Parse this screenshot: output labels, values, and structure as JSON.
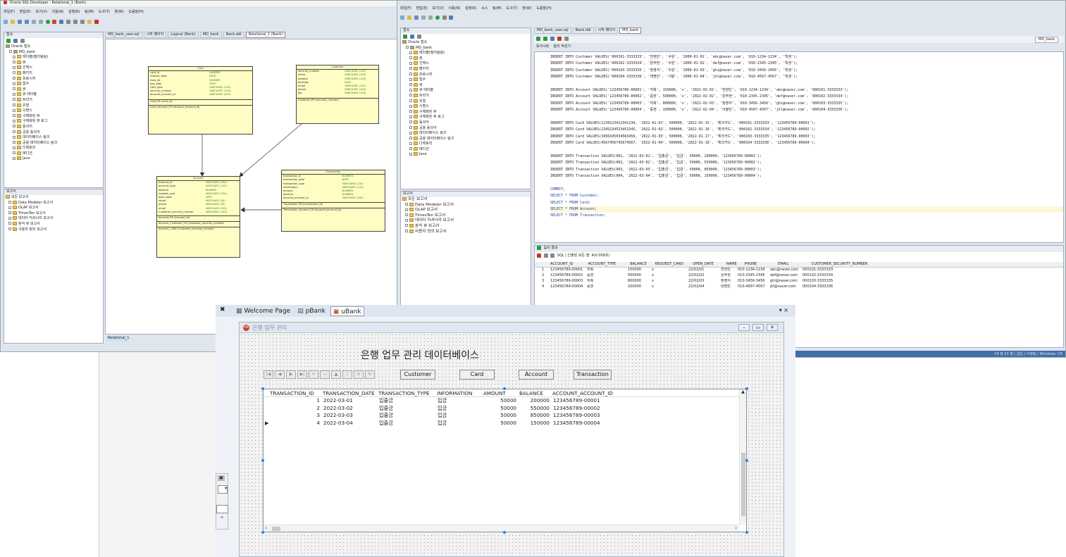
{
  "left_window": {
    "title": "Oracle SQL Developer : Relational_1 (Bank)",
    "menu": [
      "파일(F)",
      "편집(E)",
      "보기(V)",
      "이동(N)",
      "실행(R)",
      "팀(M)",
      "도구(T)",
      "창(W)",
      "도움말(H)"
    ],
    "conn_panel_title": "접속",
    "tabs": [
      "MD_bank_user.sql",
      "시작 페이지",
      "Logical (Bank)",
      "MD_bank",
      "Bank.ddl",
      "Relational_1 (Bank)"
    ],
    "tree": [
      "Oracle 접속",
      "MD_bank",
      "테이블(필터링됨)",
      "뷰",
      "인덱스",
      "패키지",
      "프로시저",
      "함수",
      "트리거",
      "유형",
      "시퀀스",
      "구체화된 뷰",
      "구체화된 뷰 로그",
      "동의어",
      "공용 동의어",
      "데이터베이스 링크",
      "공용 데이터베이스 링크",
      "디렉토리",
      "에디션",
      "Java"
    ],
    "tree_mid": [
      "큐",
      "큐 테이블"
    ],
    "report_panel_title": "보고서",
    "reports": [
      "모든 보고서",
      "Data Modeler 보고서",
      "OLAP 보고서",
      "TimesTen 보고서",
      "데이터 딕셔너리 보고서",
      "분석 뷰 보고서",
      "사용자 정의 보고서"
    ],
    "bottom_tab": "Relational_1"
  },
  "erd": {
    "card": {
      "title": "Card",
      "columns": [
        [
          "card_id",
          "NUMBER"
        ],
        [
          "request_date",
          "DATE"
        ],
        [
          "max_mt",
          "NUMBER"
        ],
        [
          "pay_date",
          "DATE"
        ],
        [
          "card_type",
          "VARCHAR2 (100)"
        ],
        [
          "security_number",
          "VARCHAR2 (100)"
        ],
        [
          "Account_account_id",
          "VARCHAR2 (200)"
        ]
      ],
      "pk": "Card_PK (card_id)",
      "fk": "Card_Account_FK (Account_account_id)"
    },
    "customer": {
      "title": "Customer",
      "columns": [
        [
          "security_number",
          "VARCHAR2 (100)"
        ],
        [
          "name",
          "VARCHAR2 (100)"
        ],
        [
          "address",
          "VARCHAR2 (100)"
        ],
        [
          "birthday",
          "DATE"
        ],
        [
          "email",
          "VARCHAR2 (100)"
        ],
        [
          "phone",
          "VARCHAR2 (100)"
        ],
        [
          "job",
          "VARCHAR2 (100)"
        ]
      ],
      "pk": "Customer_PK (security_number)"
    },
    "account": {
      "title": "Account",
      "columns": [
        [
          "account_id",
          "VARCHAR2 (200)"
        ],
        [
          "account_type",
          "VARCHAR2 (100)"
        ],
        [
          "balance",
          "NUMBER"
        ],
        [
          "request_card",
          "VARCHAR2 (100)"
        ],
        [
          "open_date",
          "DATE"
        ],
        [
          "name",
          "VARCHAR2 (50)"
        ],
        [
          "phone",
          "VARCHAR2 (50)"
        ],
        [
          "email",
          "VARCHAR2 (100)"
        ],
        [
          "Customer_security_number",
          "VARCHAR2 (100)"
        ]
      ],
      "pk": "Account_PK (account_id)",
      "fk": "Account_Customer_FK (Customer_security_number)",
      "uk": "Account__UNV (Customer_security_number)"
    },
    "transaction": {
      "title": "Transaction",
      "columns": [
        [
          "transaction_id",
          "NUMBER"
        ],
        [
          "transaction_date",
          "DATE"
        ],
        [
          "transaction_type",
          "VARCHAR2 (100)"
        ],
        [
          "information",
          "VARCHAR2 (100)"
        ],
        [
          "amount",
          "NUMBER"
        ],
        [
          "balance",
          "NUMBER"
        ],
        [
          "Account_account_id",
          "VARCHAR2 (200)"
        ]
      ],
      "pk": "Transaction_PK (transaction_id)",
      "fk": "Transaction_Account_FK (Account_account_id)"
    }
  },
  "right_window": {
    "menu": [
      "파일(F)",
      "편집(E)",
      "보기(V)",
      "이동(N)",
      "실행(R)",
      "소스",
      "팀(M)",
      "도구(T)",
      "창(W)",
      "도움말(H)"
    ],
    "tabs": [
      "MD_bank_user.sql",
      "Bank.ddl",
      "시작 페이지",
      "MD_bank"
    ],
    "conn_label": "MD_bank",
    "sub_tabs": [
      "워크시트",
      "질의 작성기"
    ],
    "code": [
      "INSERT INTO Customer VALUES('000101-3333333', '전현민', '수원', '2000-01-01', 'abc@naver.com', '010-1234-1234', '학생');",
      "INSERT INTO Customer VALUES('000102-3333334', '문주현', '수원', '2000-01-02', 'def@naver.com', '010-2345-2345', '학생');",
      "INSERT INTO Customer VALUES('000103-3333335', '정영석', '수원', '2000-01-03', 'ghi@naver.com', '010-3456-3456', '학생');",
      "INSERT INTO Customer VALUES('000104-3333336', '대명민', '서울', '2000-01-04', 'jkl@naver.com', '010-4567-4567', '학생');",
      "",
      "INSERT INTO Account VALUES('123456789-00001', '저축', 150000, 'x', '2022-02-01', '전현민', '010-1234-1234', 'abc@naver.com', '000101-3333333');",
      "INSERT INTO Account VALUES('123456789-00002', '증권', 500000, 'x', '2022-02-02', '문주현', '010-2345-2345', 'def@naver.com', '000102-3333334');",
      "INSERT INTO Account VALUES('123456789-00003', '저축', 800000, 'x', '2022-02-03', '정영석', '010-3456-3456', 'ghi@naver.com', '000103-3333335');",
      "INSERT INTO Account VALUES('123456789-00004', '증권', 100000, 'x', '2022-02-04', '이블민', '010-4567-4567', 'jkl@naver.com', '000104-3333336');",
      "",
      "INSERT INTO Card VALUES(1234123412341234, '2022-01-01', 500000, '2022-01-15', '체크카드', '000101-3333333', '123456789-00001');",
      "INSERT INTO Card VALUES(2345234523452345, '2022-01-02', 500000, '2022-01-16', '체크카드', '000102-3333334', '123456789-00002');",
      "INSERT INTO Card VALUES(3456345634563456, '2022-01-03', 500000, '2022-01-17', '체크카드', '000103-3333335', '123456789-00003');",
      "INSERT INTO Card VALUES(4567456745674567, '2022-01-04', 500000, '2022-01-18', '체크카드', '000104-3333336', '123456789-00004');",
      "",
      "INSERT INTO Transaction VALUES(001, '2022-03-01', '입출금', '입금', 50000, 200000, '123456789-00001');",
      "INSERT INTO Transaction VALUES(002, '2022-03-02', '입출금', '입금', 50000, 550000, '123456789-00002');",
      "INSERT INTO Transaction VALUES(003, '2022-03-03', '입출금', '입금', 50000, 850000, '123456789-00003');",
      "INSERT INTO Transaction VALUES(004, '2022-03-04', '입출금', '입금', 50000, 150000, '123456789-00004');",
      "",
      "COMMIT;",
      "SELECT * FROM Customer;",
      "SELECT * FROM Card;",
      "SELECT * FROM Account;",
      "SELECT * FROM Transaction;"
    ],
    "result_tab": "질의 결과",
    "result_status": "SQL | 인출된 모든 행: 4(0.008초)",
    "result_headers": [
      "ACCOUNT_ID",
      "ACCOUNT_TYPE",
      "BALANCE",
      "REQUEST_CARD",
      "OPEN_DATE",
      "NAME",
      "PHONE",
      "EMAIL",
      "CUSTOMER_SECURITY_NUMBER"
    ],
    "result_rows": [
      [
        "1",
        "123456789-00001",
        "저축",
        "150000",
        "x",
        "22/02/01",
        "전현민",
        "010-1234-1234",
        "abc@naver.com",
        "000101-3333333"
      ],
      [
        "2",
        "123456789-00002",
        "증권",
        "500000",
        "x",
        "22/02/02",
        "문주현",
        "010-2345-2345",
        "def@naver.com",
        "000102-3333334"
      ],
      [
        "3",
        "123456789-00003",
        "저축",
        "800000",
        "x",
        "22/02/03",
        "정영석",
        "010-3456-3456",
        "ghi@naver.com",
        "000103-3333335"
      ],
      [
        "4",
        "123456789-00004",
        "증권",
        "100000",
        "x",
        "22/02/04",
        "대명민",
        "010-4567-4567",
        "jkl@naver.com",
        "000104-3333336"
      ]
    ],
    "report_panel_title": "보고서",
    "reports": [
      "모든 보고서",
      "Data Modeler 보고서",
      "OLAP 보고서",
      "TimesTen 보고서",
      "데이터 딕셔너리 보고서",
      "분석 뷰 보고서",
      "사용자 정의 보고서"
    ],
    "status_text": "24 행 23 열 | 삽입 | 수정됨 | Windows: CR"
  },
  "form_designer": {
    "tabs": [
      "Welcome Page",
      "pBank",
      "uBank"
    ],
    "window_title": "은행 업무 관리",
    "heading": "은행 업무 관리 데이터베이스",
    "buttons": [
      "Customer",
      "Card",
      "Account",
      "Transaction"
    ],
    "nav_buttons": [
      "|◀",
      "◀",
      "▶",
      "▶|",
      "+",
      "−",
      "▲",
      "✓",
      "✕",
      "↻"
    ],
    "grid_headers": [
      "TRANSACTION_ID",
      "TRANSACTION_DATE",
      "TRANSACTION_TYPE",
      "INFORMATION",
      "AMOUNT",
      "BALANCE",
      "ACCOUNT_ACCOUNT_ID"
    ],
    "grid_rows": [
      [
        "1",
        "2022-03-01",
        "입출금",
        "입금",
        "50000",
        "200000",
        "123456789-00001"
      ],
      [
        "2",
        "2022-03-02",
        "입출금",
        "입금",
        "50000",
        "550000",
        "123456789-00002"
      ],
      [
        "3",
        "2022-03-03",
        "입출금",
        "입금",
        "50000",
        "850000",
        "123456789-00003"
      ],
      [
        "4",
        "2022-03-04",
        "입출금",
        "입금",
        "50000",
        "150000",
        "123456789-00004"
      ]
    ]
  },
  "colors": {
    "erd_entity": "#fffdc4",
    "sql_keyword": "#1b39a8",
    "sql_string": "#b2341b",
    "selection": "#2f7fe0"
  }
}
